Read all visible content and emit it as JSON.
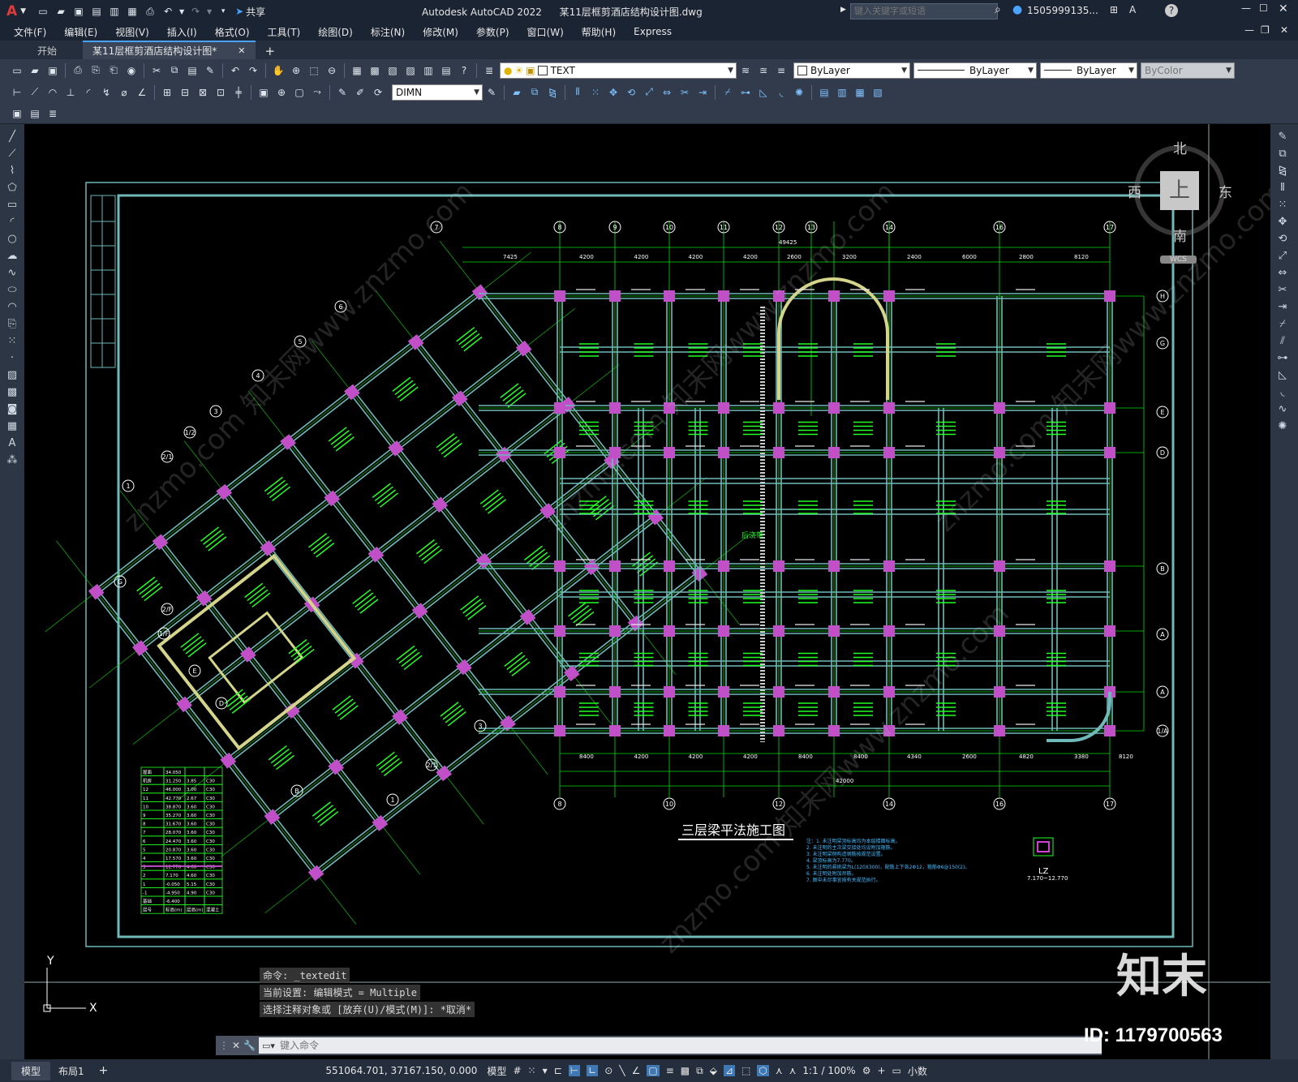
{
  "titlebar": {
    "app_title": "Autodesk AutoCAD 2022",
    "file_title": "某11层框剪酒店结构设计图.dwg",
    "share_label": "共享",
    "search_placeholder": "键入关键字或短语",
    "user_label": "1505999135...",
    "app_icon": "A"
  },
  "menu": [
    "文件(F)",
    "编辑(E)",
    "视图(V)",
    "插入(I)",
    "格式(O)",
    "工具(T)",
    "绘图(D)",
    "标注(N)",
    "修改(M)",
    "参数(P)",
    "窗口(W)",
    "帮助(H)",
    "Express"
  ],
  "tabs": {
    "start": "开始",
    "active": "某11层框剪酒店结构设计图*",
    "add": "+"
  },
  "toolbar": {
    "layer_name": "TEXT",
    "color": "ByLayer",
    "linetype": "ByLayer",
    "lineweight": "ByLayer",
    "plotstyle": "ByColor",
    "dimstyle": "DIMN"
  },
  "viewcube": {
    "north": "北",
    "south": "南",
    "east": "东",
    "west": "西",
    "top": "上",
    "wcs": "WCS"
  },
  "drawing": {
    "title": "三层梁平法施工图",
    "lz_label": "LZ",
    "lz_range": "7.170~12.770",
    "overall_dim_bottom": "42000",
    "overall_dim_top": "49425",
    "back_pour": "后浇带",
    "grid_top": [
      "7",
      "8",
      "9",
      "10",
      "11",
      "12",
      "13",
      "14",
      "16",
      "17"
    ],
    "grid_bottom": [
      "8",
      "10",
      "12",
      "14",
      "16",
      "17"
    ],
    "grid_right": [
      "H",
      "G",
      "E",
      "D",
      "B",
      "A",
      "A",
      "1/A"
    ],
    "grid_left": [
      "6",
      "5",
      "4",
      "3",
      "1/2",
      "2/1",
      "1",
      "G",
      "2/F",
      "1/F",
      "E",
      "D",
      "B",
      "1",
      "2/1",
      "3"
    ],
    "dims_top": [
      "7425",
      "4200",
      "4200",
      "4200",
      "4200",
      "2600",
      "3200",
      "2400",
      "6000",
      "2800",
      "8120"
    ],
    "dims_bottom": [
      "8400",
      "4200",
      "4200",
      "4200",
      "8400",
      "8400",
      "4340",
      "2600",
      "4820",
      "3380",
      "8120"
    ],
    "notes": [
      "注：1. 未注明梁顶标高均为本层楼面标高。",
      "2. 未注明的主次梁交接处均设附加箍筋。",
      "3. 未注明梁侧构造钢筋按规范设置。",
      "4. 梁顶标高为7.770。",
      "5. 未注明的悬挑梁为L(120X300)，配筋上下各2Φ12，箍筋Φ6@150(2)。",
      "6. 未注明处附加吊筋。",
      "7. 图中未尽事宜按有关规范执行。"
    ],
    "level_table": {
      "rows": [
        [
          "屋面",
          "34.050",
          "",
          ""
        ],
        [
          "机房",
          "31.250",
          "3.85",
          "C30"
        ],
        [
          "12",
          "46.000",
          "3.00",
          "C30"
        ],
        [
          "11",
          "42.770",
          "2.67",
          "C30"
        ],
        [
          "10",
          "38.870",
          "3.60",
          "C30"
        ],
        [
          "9",
          "35.270",
          "3.60",
          "C30"
        ],
        [
          "8",
          "31.670",
          "3.60",
          "C30"
        ],
        [
          "7",
          "28.070",
          "3.60",
          "C30"
        ],
        [
          "6",
          "24.470",
          "3.60",
          "C30"
        ],
        [
          "5",
          "20.870",
          "3.60",
          "C30"
        ],
        [
          "4",
          "17.570",
          "3.60",
          "C30"
        ],
        [
          "3",
          "12.770",
          "4.60",
          "C30"
        ],
        [
          "2",
          "7.170",
          "4.60",
          "C30"
        ],
        [
          "1",
          "-0.050",
          "5.15",
          "C30"
        ],
        [
          "-1",
          "-4.950",
          "4.90",
          "C30"
        ],
        [
          "基础",
          "-6.400",
          "",
          ""
        ],
        [
          "层号",
          "标高(m)",
          "层高(m)",
          "混凝土"
        ]
      ]
    }
  },
  "watermark": {
    "text": "znzmo.com 知末网www.znzmo.com",
    "brand": "知末",
    "id_label": "ID: 1179700563"
  },
  "command": {
    "history": [
      "命令: _textedit",
      "当前设置: 编辑模式 = Multiple",
      "选择注释对象或 [放弃(U)/模式(M)]: *取消*"
    ],
    "placeholder": "键入命令"
  },
  "ucs": {
    "x": "X",
    "y": "Y"
  },
  "status": {
    "model_tab": "模型",
    "layout_tab": "布局1",
    "add": "+",
    "coords": "551064.701, 37167.150, 0.000",
    "mode": "模型",
    "scale": "1:1 / 100%",
    "units": "小数"
  },
  "colors": {
    "beam": "#6fb9b9",
    "grid": "#00dd00",
    "column": "#c04fc8",
    "wall": "#d4d48a",
    "frame": "#6fb9b9",
    "text_beam": "#e8e8e8",
    "annot_green": "#22ff22"
  }
}
